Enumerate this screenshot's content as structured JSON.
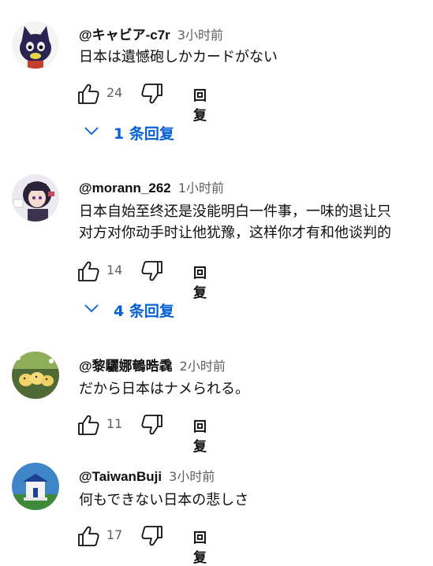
{
  "comments": [
    {
      "author": "@キャビア-c7r",
      "time": "3小时前",
      "lines": [
        "日本は遺憾砲しかカードがない"
      ],
      "likes": "24",
      "reply_label": "回复",
      "replies_label": "1 条回复",
      "avatar_icon": "cat-avatar-icon"
    },
    {
      "author": "@morann_262",
      "time": "1小时前",
      "lines": [
        "日本自始至终还是没能明白一件事，一味的退让只",
        "对方对你动手时让他犹豫，这样你才有和他谈判的"
      ],
      "likes": "14",
      "reply_label": "回复",
      "replies_label": "4 条回复",
      "avatar_icon": "anime-girl-avatar-icon"
    },
    {
      "author": "@黎驪娜鵪晧毳",
      "time": "2小时前",
      "lines": [
        "だから日本はナメられる。"
      ],
      "likes": "11",
      "reply_label": "回复",
      "avatar_icon": "chicks-avatar-icon"
    },
    {
      "author": "@TaiwanBuji",
      "time": "3小时前",
      "lines": [
        "何もできない日本の悲しさ"
      ],
      "likes": "17",
      "reply_label": "回复",
      "avatar_icon": "memorial-hall-avatar-icon"
    }
  ],
  "colors": {
    "link": "#065fd4",
    "meta": "#606060",
    "text": "#0f0f0f"
  }
}
